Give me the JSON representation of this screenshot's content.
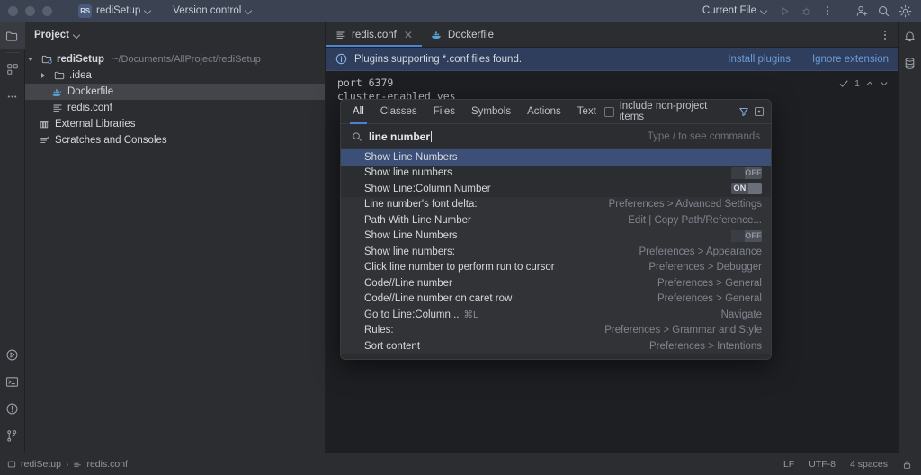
{
  "titlebar": {
    "project_badge": "RS",
    "project_name": "rediSetup",
    "version_control": "Version control",
    "run_config": "Current File",
    "icons": {
      "run": "run-icon",
      "debug": "debug-icon",
      "more": "more-vertical-icon",
      "share": "add-user-icon",
      "search": "search-icon",
      "settings": "gear-icon"
    }
  },
  "left_rail": {
    "project_icon": "project-folder-icon",
    "structure_icon": "structure-icon",
    "more_icon": "more-horizontal-icon",
    "run_icon": "run-panel-icon",
    "terminal_icon": "terminal-icon",
    "problems_icon": "problems-icon",
    "git_icon": "git-branch-icon"
  },
  "right_rail": {
    "notifications_icon": "bell-icon",
    "database_icon": "database-icon"
  },
  "project_panel": {
    "title": "Project",
    "tree": [
      {
        "label": "rediSetup",
        "path": "~/Documents/AllProject/rediSetup",
        "icon": "module-icon",
        "indent": 0,
        "arrow": "open",
        "bold": true,
        "selected": false
      },
      {
        "label": ".idea",
        "path": "",
        "icon": "folder-icon",
        "indent": 1,
        "arrow": "closed",
        "bold": false,
        "selected": false
      },
      {
        "label": "Dockerfile",
        "path": "",
        "icon": "docker-icon",
        "indent": 2,
        "arrow": "none",
        "bold": false,
        "selected": true
      },
      {
        "label": "redis.conf",
        "path": "",
        "icon": "conf-file-icon",
        "indent": 2,
        "arrow": "none",
        "bold": false,
        "selected": false
      },
      {
        "label": "External Libraries",
        "path": "",
        "icon": "libraries-icon",
        "indent": 1,
        "arrow": "none",
        "bold": false,
        "selected": false
      },
      {
        "label": "Scratches and Consoles",
        "path": "",
        "icon": "scratches-icon",
        "indent": 1,
        "arrow": "none",
        "bold": false,
        "selected": false
      }
    ]
  },
  "editor": {
    "tabs": [
      {
        "label": "redis.conf",
        "icon": "conf-file-icon",
        "active": true,
        "closable": true
      },
      {
        "label": "Dockerfile",
        "icon": "docker-icon",
        "active": false,
        "closable": false
      }
    ],
    "tab_more_icon": "more-vertical-icon",
    "notification": {
      "icon": "info-icon",
      "text": "Plugins supporting *.conf files found.",
      "links": [
        "Install plugins",
        "Ignore extension"
      ]
    },
    "code_lines": [
      "port 6379",
      "cluster-enabled yes"
    ],
    "inspection": {
      "icon": "inspection-check-icon",
      "count": "1",
      "up": "chevron-up-icon",
      "down": "chevron-down-icon"
    }
  },
  "search_everywhere": {
    "tabs": [
      {
        "label": "All",
        "active": true
      },
      {
        "label": "Classes",
        "active": false
      },
      {
        "label": "Files",
        "active": false
      },
      {
        "label": "Symbols",
        "active": false
      },
      {
        "label": "Actions",
        "active": false
      },
      {
        "label": "Text",
        "active": false
      }
    ],
    "include_non_project": {
      "label": "Include non-project items",
      "checked": false
    },
    "filter_icon": "filter-funnel-icon",
    "options_icon": "options-square-icon",
    "search": {
      "icon": "search-icon",
      "value": "line number",
      "placeholder": "Type / to see commands"
    },
    "results": [
      {
        "title": "Show Line Numbers",
        "shortcut": "",
        "right": "",
        "toggle": "",
        "selected": true,
        "alt": false
      },
      {
        "title": "Show line numbers",
        "shortcut": "",
        "right": "",
        "toggle": "off",
        "selected": false,
        "alt": false
      },
      {
        "title": "Show Line:Column Number",
        "shortcut": "",
        "right": "",
        "toggle": "on",
        "selected": false,
        "alt": false
      },
      {
        "title": "Line number's font delta:",
        "shortcut": "",
        "right": "Preferences > Advanced Settings",
        "toggle": "",
        "selected": false,
        "alt": true
      },
      {
        "title": "Path With Line Number",
        "shortcut": "",
        "right": "Edit | Copy Path/Reference...",
        "toggle": "",
        "selected": false,
        "alt": true
      },
      {
        "title": "Show Line Numbers",
        "shortcut": "",
        "right": "",
        "toggle": "off",
        "selected": false,
        "alt": true
      },
      {
        "title": "Show line numbers:",
        "shortcut": "",
        "right": "Preferences > Appearance",
        "toggle": "",
        "selected": false,
        "alt": true
      },
      {
        "title": "Click line number to perform run to cursor",
        "shortcut": "",
        "right": "Preferences > Debugger",
        "toggle": "",
        "selected": false,
        "alt": true
      },
      {
        "title": "Code//Line number",
        "shortcut": "",
        "right": "Preferences > General",
        "toggle": "",
        "selected": false,
        "alt": true
      },
      {
        "title": "Code//Line number on caret row",
        "shortcut": "",
        "right": "Preferences > General",
        "toggle": "",
        "selected": false,
        "alt": true
      },
      {
        "title": "Go to Line:Column...",
        "shortcut": "⌘L",
        "right": "Navigate",
        "toggle": "",
        "selected": false,
        "alt": true
      },
      {
        "title": "Rules:",
        "shortcut": "",
        "right": "Preferences > Grammar and Style",
        "toggle": "",
        "selected": false,
        "alt": true
      },
      {
        "title": "Sort content",
        "shortcut": "",
        "right": "Preferences > Intentions",
        "toggle": "",
        "selected": false,
        "alt": true
      }
    ]
  },
  "statusbar": {
    "breadcrumb": [
      "rediSetup",
      "redis.conf"
    ],
    "separator": "›",
    "line_separator": "LF",
    "encoding": "UTF-8",
    "indent": "4 spaces",
    "lock_icon": "lock-icon"
  },
  "colors": {
    "accent": "#4a83d4",
    "selection": "#3c4f76",
    "notification_bg": "#2e3e5c",
    "panel_bg": "#2b2d30",
    "editor_bg": "#1e1f22"
  }
}
